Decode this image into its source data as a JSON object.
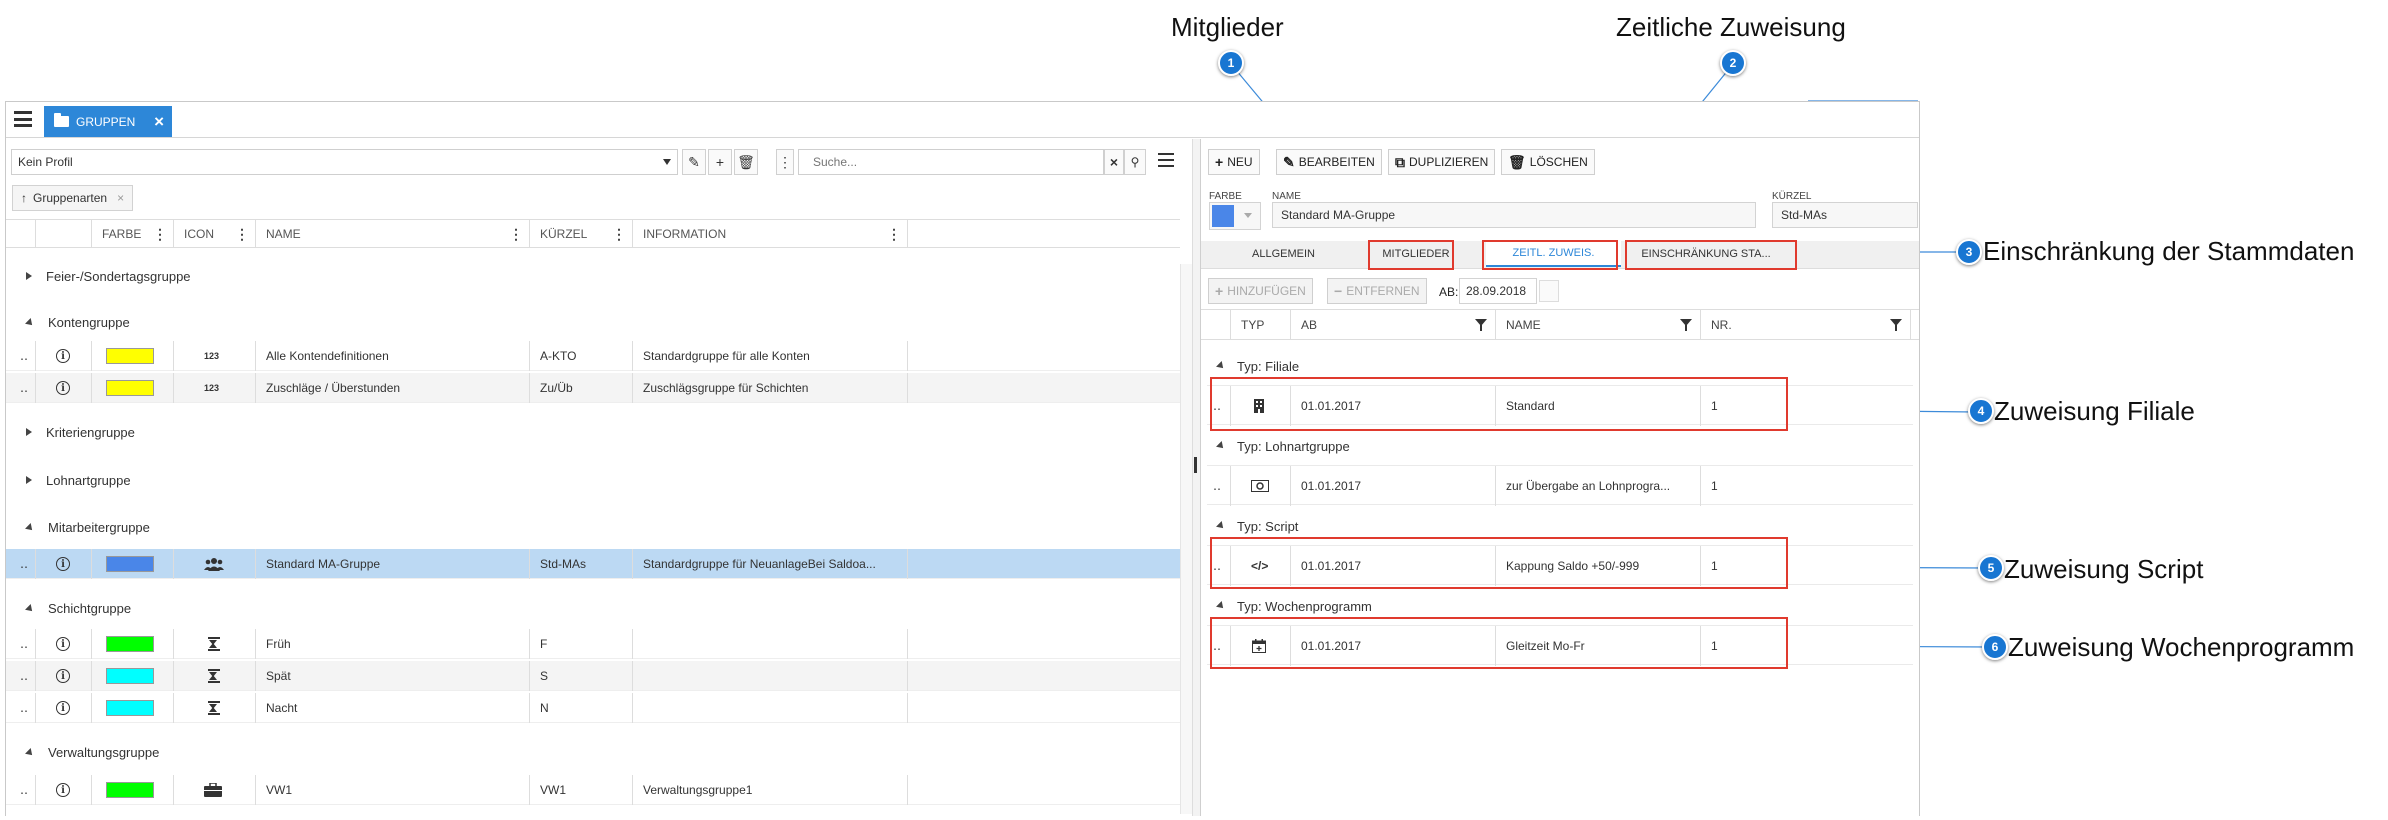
{
  "callouts": {
    "mitglieder": {
      "num": "1",
      "label": "Mitglieder"
    },
    "zeitlich": {
      "num": "2",
      "label": "Zeitliche Zuweisung"
    },
    "einschraenkung": {
      "num": "3",
      "label": "Einschränkung der Stammdaten"
    },
    "filiale": {
      "num": "4",
      "label": "Zuweisung Filiale"
    },
    "script": {
      "num": "5",
      "label": "Zuweisung Script"
    },
    "wochenprogramm": {
      "num": "6",
      "label": "Zuweisung Wochenprogramm"
    }
  },
  "topbar": {
    "tab_label": "GRUPPEN"
  },
  "left": {
    "profile_select": "Kein Profil",
    "search_placeholder": "Suche...",
    "group_chip": "Gruppenarten",
    "columns": [
      "FARBE",
      "ICON",
      "NAME",
      "KÜRZEL",
      "INFORMATION"
    ],
    "groups": [
      {
        "label": "Feier-/Sondertagsgruppe",
        "expanded": false
      },
      {
        "label": "Kontengruppe",
        "expanded": true
      },
      {
        "label": "Kriteriengruppe",
        "expanded": false
      },
      {
        "label": "Lohnartgruppe",
        "expanded": false
      },
      {
        "label": "Mitarbeitergruppe",
        "expanded": true
      },
      {
        "label": "Schichtgruppe",
        "expanded": true
      },
      {
        "label": "Verwaltungsgruppe",
        "expanded": true
      }
    ],
    "rows": [
      {
        "color": "#ffff00",
        "icon": "123",
        "name": "Alle Kontendefinitionen",
        "short": "A-KTO",
        "info": "Standardgruppe für alle Konten"
      },
      {
        "color": "#ffff00",
        "icon": "123",
        "name": "Zuschläge / Überstunden",
        "short": "Zu/Üb",
        "info": "Zuschlägsgruppe für Schichten"
      },
      {
        "color": "#4a86e8",
        "icon": "users-icon",
        "name": "Standard MA-Gruppe",
        "short": "Std-MAs",
        "info": "Standardgruppe für NeuanlageBei Saldoa..."
      },
      {
        "color": "#00ff00",
        "icon": "hourglass-icon",
        "name": "Früh",
        "short": "F",
        "info": ""
      },
      {
        "color": "#00ffff",
        "icon": "hourglass-icon",
        "name": "Spät",
        "short": "S",
        "info": ""
      },
      {
        "color": "#00ffff",
        "icon": "hourglass-icon",
        "name": "Nacht",
        "short": "N",
        "info": ""
      },
      {
        "color": "#00ff00",
        "icon": "briefcase-icon",
        "name": "VW1",
        "short": "VW1",
        "info": "Verwaltungsgruppe1"
      }
    ]
  },
  "right": {
    "toolbar": {
      "new": "NEU",
      "edit": "BEARBEITEN",
      "duplicate": "DUPLIZIEREN",
      "delete": "LÖSCHEN"
    },
    "form": {
      "color_label": "FARBE",
      "color": "#4a86e8",
      "name_label": "NAME",
      "name_value": "Standard MA-Gruppe",
      "short_label": "KÜRZEL",
      "short_value": "Std-MAs"
    },
    "tabs": [
      "ALLGEMEIN",
      "MITGLIEDER",
      "ZEITL. ZUWEIS.",
      "EINSCHRÄNKUNG STA..."
    ],
    "active_tab": 2,
    "assign": {
      "add": "HINZUFÜGEN",
      "remove": "ENTFERNEN",
      "from_label": "AB:",
      "from_value": "28.09.2018"
    },
    "columns": [
      "TYP",
      "AB",
      "NAME",
      "NR."
    ],
    "groups": [
      {
        "label": "Typ: Filiale",
        "row": {
          "icon": "building-icon",
          "from": "01.01.2017",
          "name": "Standard",
          "nr": "1"
        }
      },
      {
        "label": "Typ: Lohnartgruppe",
        "row": {
          "icon": "money-icon",
          "from": "01.01.2017",
          "name": "zur Übergabe an Lohnprogra...",
          "nr": "1"
        }
      },
      {
        "label": "Typ: Script",
        "row": {
          "icon": "code-icon",
          "from": "01.01.2017",
          "name": "Kappung Saldo +50/-999",
          "nr": "1"
        }
      },
      {
        "label": "Typ: Wochenprogramm",
        "row": {
          "icon": "calendar-icon",
          "from": "01.01.2017",
          "name": "Gleitzeit Mo-Fr",
          "nr": "1"
        }
      }
    ]
  }
}
